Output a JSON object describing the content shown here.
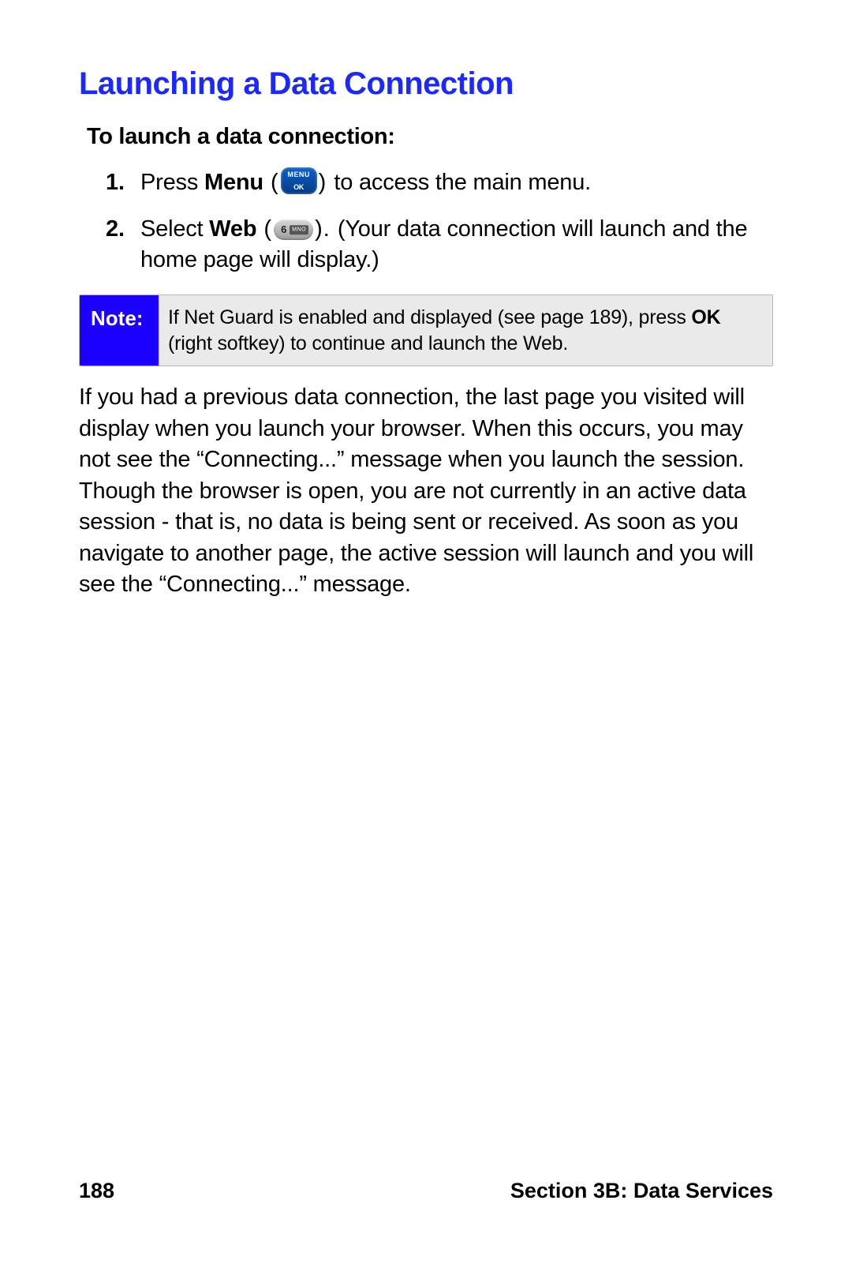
{
  "title": "Launching a Data Connection",
  "intro": "To launch a data connection:",
  "steps": {
    "s1": {
      "pre": "Press ",
      "bold": "Menu",
      "open_paren": " (",
      "close_paren": ") ",
      "post": "to access the main menu."
    },
    "s2": {
      "pre": "Select ",
      "bold": "Web",
      "open_paren": " (",
      "close_paren": "). ",
      "post": "(Your data connection will launch and the home page will display.)"
    }
  },
  "note": {
    "label": "Note:",
    "text_pre": "If Net Guard is enabled and displayed (see page 189), press ",
    "ok_bold": "OK ",
    "text_post": "(right softkey) to continue and launch the Web."
  },
  "paragraph": "If you had a previous data connection, the last page you visited will display when you launch your browser. When this occurs, you may not see the “Connecting...” message when you launch the session. Though the browser is open, you are not currently in an active data session - that is, no data is being sent or received. As soon as you navigate to another page, the active session will launch and you will see the “Connecting...” message.",
  "footer": {
    "page_number": "188",
    "section": "Section 3B: Data Services"
  },
  "icons": {
    "menu_key": "menu-ok-key",
    "six_key": "6-mno-key"
  }
}
